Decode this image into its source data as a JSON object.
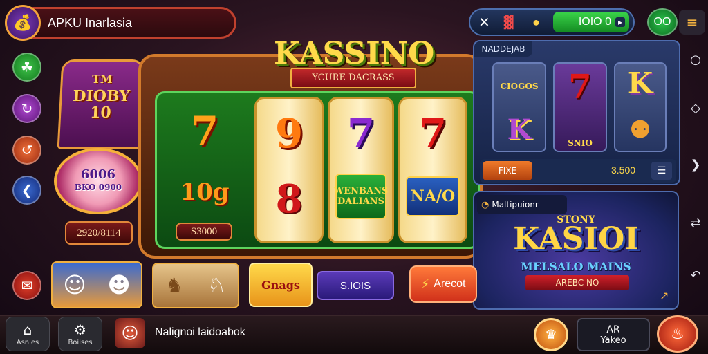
{
  "header": {
    "brand_name": "APKU Inarlasia"
  },
  "left_cabinet": {
    "sign_top": "TM",
    "sign_title": "DIOBY",
    "sign_number": "10",
    "wheel_value": "6006",
    "wheel_sub": "BKO 0900",
    "plate_value": "2920/8114"
  },
  "machine": {
    "title": "KASSINO",
    "ribbon": "YCURE DACRASS",
    "reels": [
      {
        "top": "7",
        "middle": "10g",
        "bottom_label": "S3000"
      },
      {
        "top": "9",
        "middle": "8"
      },
      {
        "top": "7",
        "tile": "WENBANS DALIANS"
      },
      {
        "top": "7",
        "tile": "NA/O"
      }
    ]
  },
  "top_bar": {
    "balance": "IOIO 0",
    "level": "OO"
  },
  "game_panel": {
    "heading": "NADDEJAB",
    "cells": [
      {
        "label": "CIOGOS"
      },
      {
        "label": "7"
      },
      {
        "label": "K"
      },
      {
        "label": "K"
      },
      {
        "label": "SNIO"
      },
      {
        "label": ""
      }
    ],
    "bet_label": "FIXE",
    "bet_value": "3.500"
  },
  "promo_panel": {
    "heading": "Maltipuionr",
    "logo_line1": "STONY",
    "logo_line2": "KASIOI",
    "logo_line3": "MELSALO MAINS",
    "logo_ribbon": "AREBC NO"
  },
  "bottom_row": {
    "card_label": "Gnags",
    "stake": "S.IOIS",
    "action_button": "Arecot"
  },
  "bottom_nav": {
    "home_label": "Asnies",
    "settings_label": "Boiises",
    "player_caption": "Nalignoi laidoabok",
    "right_box_line1": "AR",
    "right_box_line2": "Yakeo"
  },
  "colors": {
    "green_accent": "#3ad44a",
    "gold": "#ffd94a",
    "red_accent": "#c0282a",
    "panel_blue": "#2a3a6a"
  }
}
